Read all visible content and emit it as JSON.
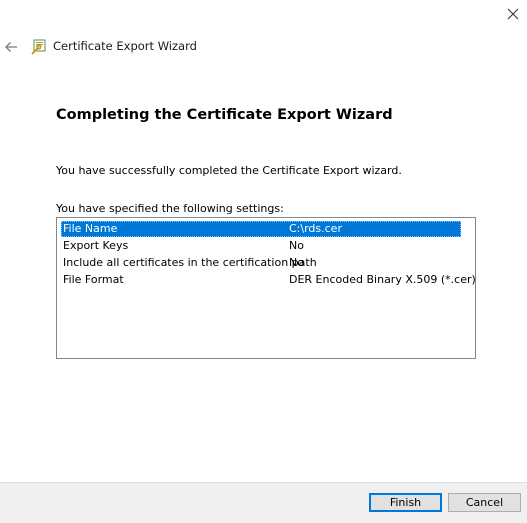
{
  "window": {
    "title": "Certificate Export Wizard",
    "close_icon": "close-icon",
    "back_icon": "back-arrow-icon",
    "wizard_icon": "certificate-wizard-icon"
  },
  "content": {
    "heading": "Completing the Certificate Export Wizard",
    "success_text": "You have successfully completed the Certificate Export wizard.",
    "settings_label": "You have specified the following settings:"
  },
  "settings": [
    {
      "name": "File Name",
      "value": "C:\\rds.cer",
      "selected": true
    },
    {
      "name": "Export Keys",
      "value": "No",
      "selected": false
    },
    {
      "name": "Include all certificates in the certification path",
      "value": "No",
      "selected": false
    },
    {
      "name": "File Format",
      "value": "DER Encoded Binary X.509 (*.cer)",
      "selected": false
    }
  ],
  "buttons": {
    "finish": "Finish",
    "cancel": "Cancel"
  },
  "colors": {
    "selection": "#0078d7",
    "footer_bg": "#f0f0f0",
    "button_bg": "#e1e1e1"
  }
}
